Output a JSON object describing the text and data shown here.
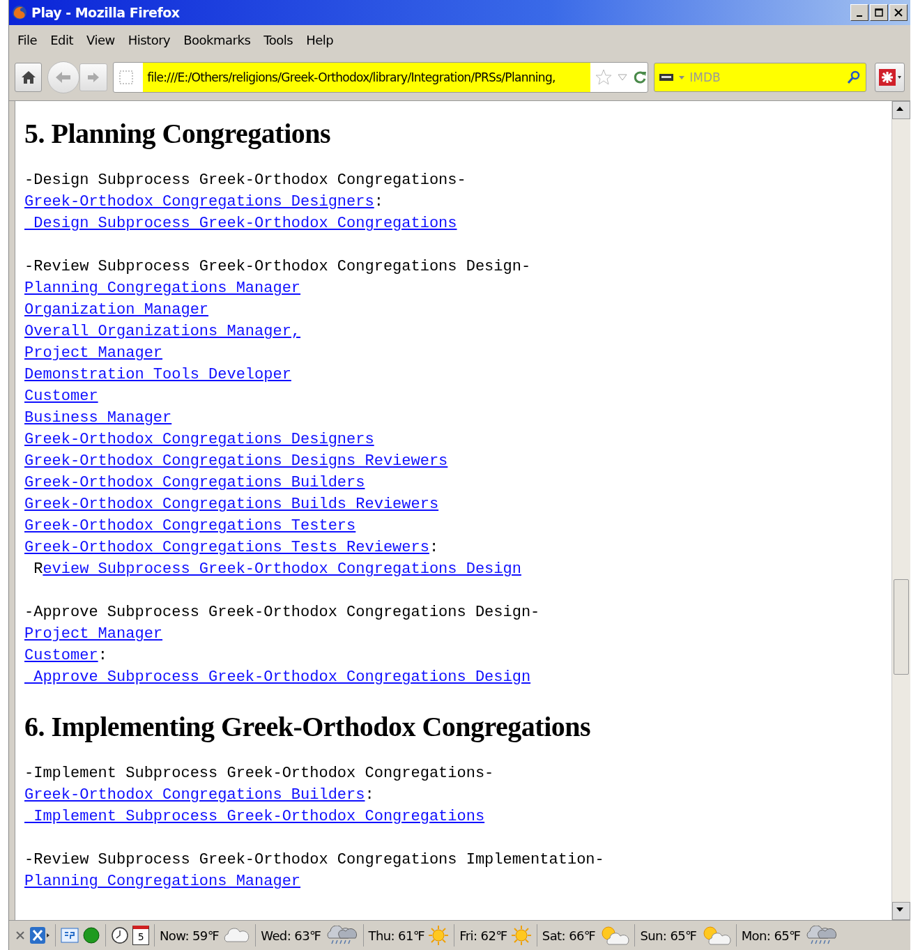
{
  "window": {
    "title": "Play - Mozilla Firefox"
  },
  "menu": [
    "File",
    "Edit",
    "View",
    "History",
    "Bookmarks",
    "Tools",
    "Help"
  ],
  "address_bar": {
    "value": "file:///E:/Others/religions/Greek-Orthodox/library/Integration/PRSs/Planning,"
  },
  "search": {
    "placeholder": "IMDB"
  },
  "sections": [
    {
      "heading": "5. Planning Congregations",
      "groups": [
        [
          [
            {
              "text": "-Design Subprocess Greek-Orthodox Congregations-",
              "link": false
            }
          ],
          [
            {
              "text": "Greek-Orthodox Congregations Designers",
              "link": true
            },
            {
              "text": ":",
              "link": false
            }
          ],
          [
            {
              "text": " Design Subprocess Greek-Orthodox Congregations",
              "link": true
            }
          ]
        ],
        [
          [
            {
              "text": "-Review Subprocess Greek-Orthodox Congregations Design-",
              "link": false
            }
          ],
          [
            {
              "text": "Planning Congregations Manager",
              "link": true
            }
          ],
          [
            {
              "text": "Organization Manager",
              "link": true
            }
          ],
          [
            {
              "text": "Overall Organizations Manager,",
              "link": true
            }
          ],
          [
            {
              "text": "Project Manager",
              "link": true
            }
          ],
          [
            {
              "text": "Demonstration Tools Developer",
              "link": true
            }
          ],
          [
            {
              "text": "Customer",
              "link": true
            }
          ],
          [
            {
              "text": "Business Manager",
              "link": true
            }
          ],
          [
            {
              "text": "Greek-Orthodox Congregations Designers",
              "link": true
            }
          ],
          [
            {
              "text": "Greek-Orthodox Congregations Designs Reviewers",
              "link": true
            }
          ],
          [
            {
              "text": "Greek-Orthodox Congregations Builders",
              "link": true
            }
          ],
          [
            {
              "text": "Greek-Orthodox Congregations Builds Reviewers",
              "link": true
            }
          ],
          [
            {
              "text": "Greek-Orthodox Congregations Testers",
              "link": true
            }
          ],
          [
            {
              "text": "Greek-Orthodox Congregations Tests Reviewers",
              "link": true
            },
            {
              "text": ":",
              "link": false
            }
          ],
          [
            {
              "text": " R",
              "link": false
            },
            {
              "text": "eview Subprocess Greek-Orthodox Congregations Design",
              "link": true
            }
          ]
        ],
        [
          [
            {
              "text": "-Approve Subprocess Greek-Orthodox Congregations Design-",
              "link": false
            }
          ],
          [
            {
              "text": "Project Manager",
              "link": true
            }
          ],
          [
            {
              "text": "Customer",
              "link": true
            },
            {
              "text": ":",
              "link": false
            }
          ],
          [
            {
              "text": " Approve Subprocess Greek-Orthodox Congregations Design",
              "link": true
            }
          ]
        ]
      ]
    },
    {
      "heading": "6. Implementing Greek-Orthodox Congregations",
      "groups": [
        [
          [
            {
              "text": "-Implement Subprocess Greek-Orthodox Congregations-",
              "link": false
            }
          ],
          [
            {
              "text": "Greek-Orthodox Congregations Builders",
              "link": true
            },
            {
              "text": ":",
              "link": false
            }
          ],
          [
            {
              "text": " Implement Subprocess Greek-Orthodox Congregations",
              "link": true
            }
          ]
        ],
        [
          [
            {
              "text": "-Review Subprocess Greek-Orthodox Congregations Implementation-",
              "link": false
            }
          ],
          [
            {
              "text": "Planning Congregations Manager",
              "link": true
            }
          ]
        ]
      ]
    }
  ],
  "status_bar": {
    "calendar_day": "5",
    "weather": [
      {
        "label": "Now: 59℉",
        "kind": "cloud"
      },
      {
        "label": "Wed: 63℉",
        "kind": "rain"
      },
      {
        "label": "Thu: 61℉",
        "kind": "sun"
      },
      {
        "label": "Fri: 62℉",
        "kind": "sun"
      },
      {
        "label": "Sat: 66℉",
        "kind": "partly"
      },
      {
        "label": "Sun: 65℉",
        "kind": "partly"
      },
      {
        "label": "Mon: 65℉",
        "kind": "rain"
      }
    ]
  }
}
